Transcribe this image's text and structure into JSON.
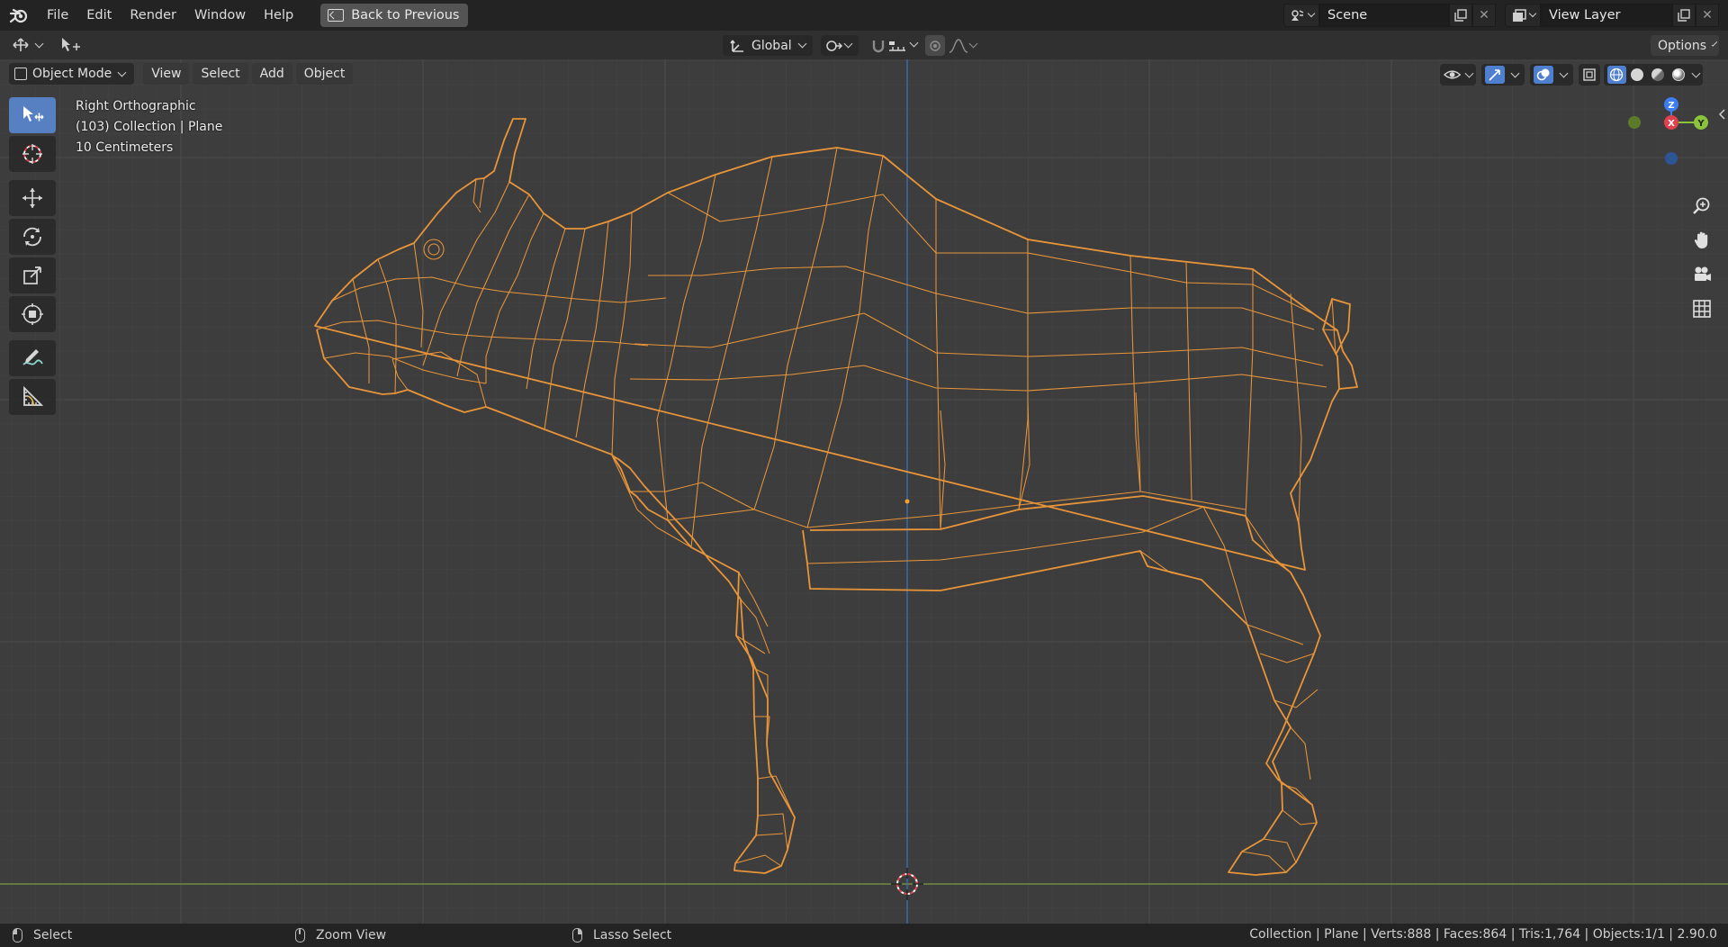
{
  "menubar": {
    "items": [
      "File",
      "Edit",
      "Render",
      "Window",
      "Help"
    ],
    "back_button": "Back to Previous"
  },
  "scene": {
    "name": "Scene",
    "view_layer": "View Layer"
  },
  "tool_header": {
    "transform_orientation": "Global",
    "options_label": "Options"
  },
  "viewport_header": {
    "mode": "Object Mode",
    "menus": [
      "View",
      "Select",
      "Add",
      "Object"
    ]
  },
  "overlay": {
    "view_name": "Right Orthographic",
    "collection_info": "(103) Collection | Plane",
    "grid_scale": "10 Centimeters"
  },
  "gizmo": {
    "z": "Z",
    "x": "X",
    "y": "Y"
  },
  "statusbar": {
    "left_click": "Select",
    "middle_click": "Zoom View",
    "right_click": "Lasso Select",
    "stats": "Collection | Plane | Verts:888 | Faces:864 | Tris:1,764 | Objects:1/1 | 2.90.0"
  },
  "colors": {
    "wire_selected": "#e8953a",
    "active_tool": "#5680c2",
    "axis_x": "#e0414d",
    "axis_y": "#8bc43a",
    "axis_z": "#3a7ef0",
    "ground_line": "#7c9a42",
    "vertical_axis": "#3a6fb8"
  },
  "icons": {
    "toolbar": [
      "select-box-icon",
      "cursor-icon",
      "move-icon",
      "rotate-icon",
      "scale-icon",
      "transform-icon",
      "annotate-icon",
      "measure-icon"
    ],
    "navigation": [
      "zoom-icon",
      "pan-hand-icon",
      "camera-icon",
      "grid-ortho-icon"
    ]
  }
}
